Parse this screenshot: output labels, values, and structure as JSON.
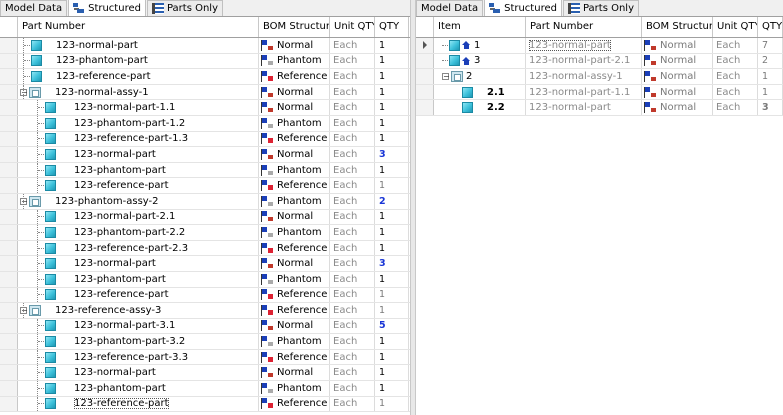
{
  "left": {
    "tabs": [
      "Model Data",
      "Structured",
      "Parts Only"
    ],
    "columns": [
      "Part Number",
      "BOM Structure",
      "Unit QTY",
      "QTY"
    ],
    "rows": [
      {
        "name": "123-normal-part",
        "bom": "Normal",
        "unit": "Each",
        "qty": "1",
        "level": 0,
        "icon": "part"
      },
      {
        "name": "123-phantom-part",
        "bom": "Phantom",
        "unit": "Each",
        "qty": "1",
        "level": 0,
        "icon": "part"
      },
      {
        "name": "123-reference-part",
        "bom": "Reference",
        "unit": "Each",
        "qty": "1",
        "level": 0,
        "icon": "part"
      },
      {
        "name": "123-normal-assy-1",
        "bom": "Normal",
        "unit": "Each",
        "qty": "1",
        "level": 0,
        "icon": "assy"
      },
      {
        "name": "123-normal-part-1.1",
        "bom": "Normal",
        "unit": "Each",
        "qty": "1",
        "level": 1,
        "icon": "part"
      },
      {
        "name": "123-phantom-part-1.2",
        "bom": "Phantom",
        "unit": "Each",
        "qty": "1",
        "level": 1,
        "icon": "part"
      },
      {
        "name": "123-reference-part-1.3",
        "bom": "Reference",
        "unit": "Each",
        "qty": "1",
        "level": 1,
        "icon": "part"
      },
      {
        "name": "123-normal-part",
        "bom": "Normal",
        "unit": "Each",
        "qty": "3",
        "level": 1,
        "icon": "part",
        "bold": true
      },
      {
        "name": "123-phantom-part",
        "bom": "Phantom",
        "unit": "Each",
        "qty": "1",
        "level": 1,
        "icon": "part"
      },
      {
        "name": "123-reference-part",
        "bom": "Reference",
        "unit": "Each",
        "qty": "1",
        "level": 1,
        "icon": "part",
        "faded": true
      },
      {
        "name": "123-phantom-assy-2",
        "bom": "Phantom",
        "unit": "Each",
        "qty": "2",
        "level": 0,
        "icon": "assy",
        "bold": true
      },
      {
        "name": "123-normal-part-2.1",
        "bom": "Normal",
        "unit": "Each",
        "qty": "1",
        "level": 1,
        "icon": "part"
      },
      {
        "name": "123-phantom-part-2.2",
        "bom": "Phantom",
        "unit": "Each",
        "qty": "1",
        "level": 1,
        "icon": "part"
      },
      {
        "name": "123-reference-part-2.3",
        "bom": "Reference",
        "unit": "Each",
        "qty": "1",
        "level": 1,
        "icon": "part"
      },
      {
        "name": "123-normal-part",
        "bom": "Normal",
        "unit": "Each",
        "qty": "3",
        "level": 1,
        "icon": "part",
        "bold": true
      },
      {
        "name": "123-phantom-part",
        "bom": "Phantom",
        "unit": "Each",
        "qty": "1",
        "level": 1,
        "icon": "part"
      },
      {
        "name": "123-reference-part",
        "bom": "Reference",
        "unit": "Each",
        "qty": "1",
        "level": 1,
        "icon": "part",
        "faded": true
      },
      {
        "name": "123-reference-assy-3",
        "bom": "Reference",
        "unit": "Each",
        "qty": "1",
        "level": 0,
        "icon": "assy",
        "faded": true
      },
      {
        "name": "123-normal-part-3.1",
        "bom": "Normal",
        "unit": "Each",
        "qty": "5",
        "level": 1,
        "icon": "part",
        "bold": true
      },
      {
        "name": "123-phantom-part-3.2",
        "bom": "Phantom",
        "unit": "Each",
        "qty": "1",
        "level": 1,
        "icon": "part"
      },
      {
        "name": "123-reference-part-3.3",
        "bom": "Reference",
        "unit": "Each",
        "qty": "1",
        "level": 1,
        "icon": "part"
      },
      {
        "name": "123-normal-part",
        "bom": "Normal",
        "unit": "Each",
        "qty": "1",
        "level": 1,
        "icon": "part"
      },
      {
        "name": "123-phantom-part",
        "bom": "Phantom",
        "unit": "Each",
        "qty": "1",
        "level": 1,
        "icon": "part"
      },
      {
        "name": "123-reference-part",
        "bom": "Reference",
        "unit": "Each",
        "qty": "1",
        "level": 1,
        "icon": "part",
        "faded": true,
        "selected": true
      }
    ]
  },
  "right": {
    "tabs": [
      "Model Data",
      "Structured",
      "Parts Only"
    ],
    "columns": [
      "Item",
      "Part Number",
      "BOM Structure",
      "Unit QTY",
      "QTY"
    ],
    "rows": [
      {
        "item": "1",
        "name": "123-normal-part",
        "bom": "Normal",
        "unit": "Each",
        "qty": "7",
        "level": 0,
        "icon": "part",
        "house": true,
        "current": true
      },
      {
        "item": "3",
        "name": "123-normal-part-2.1",
        "bom": "Normal",
        "unit": "Each",
        "qty": "2",
        "level": 0,
        "icon": "part",
        "house": true
      },
      {
        "item": "2",
        "name": "123-normal-assy-1",
        "bom": "Normal",
        "unit": "Each",
        "qty": "1",
        "level": 0,
        "icon": "assy"
      },
      {
        "item": "2.1",
        "name": "123-normal-part-1.1",
        "bom": "Normal",
        "unit": "Each",
        "qty": "1",
        "level": 1,
        "icon": "part"
      },
      {
        "item": "2.2",
        "name": "123-normal-part",
        "bom": "Normal",
        "unit": "Each",
        "qty": "3",
        "level": 1,
        "icon": "part",
        "bold": true
      }
    ]
  }
}
